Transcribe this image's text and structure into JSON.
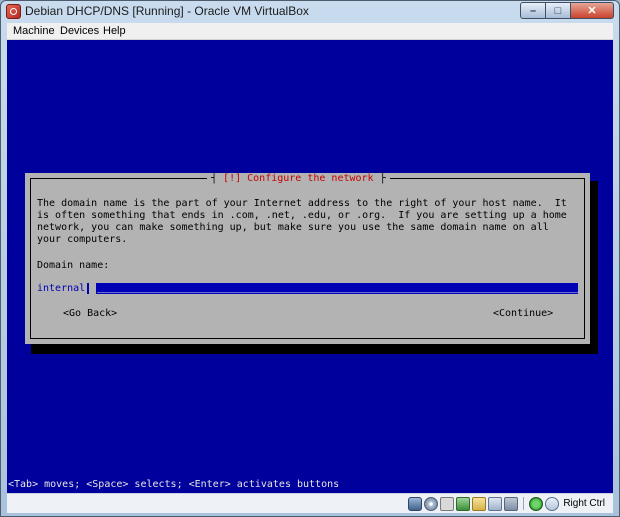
{
  "window": {
    "title": "Debian DHCP/DNS [Running] - Oracle VM VirtualBox",
    "buttons": {
      "minimize": "–",
      "maximize": "□",
      "close": "✕"
    }
  },
  "menubar": {
    "items": [
      "Machine",
      "Devices",
      "Help"
    ]
  },
  "dialog": {
    "title_prefix": "[!]",
    "title": "Configure the network",
    "description": "The domain name is the part of your Internet address to the right of your host name.  It\nis often something that ends in .com, .net, .edu, or .org.  If you are setting up a home\nnetwork, you can make something up, but make sure you use the same domain name on all\nyour computers.",
    "field_label": "Domain name:",
    "field_value": "internal",
    "back_button": "<Go Back>",
    "continue_button": "<Continue>"
  },
  "help_line": "<Tab> moves; <Space> selects; <Enter> activates buttons",
  "statusbar": {
    "icons": [
      "hard-disk-icon",
      "cd-drive-icon",
      "usb-icon",
      "network-icon",
      "shared-folder-icon",
      "display-icon",
      "capture-icon",
      "mouse-integration-icon",
      "host-key-arrow-icon"
    ],
    "host_key": "Right Ctrl"
  },
  "colors": {
    "guest_background": "#00009c",
    "dialog_background": "#b3b3b3",
    "dialog_title": "#c80000",
    "field_background": "#0000b4"
  }
}
